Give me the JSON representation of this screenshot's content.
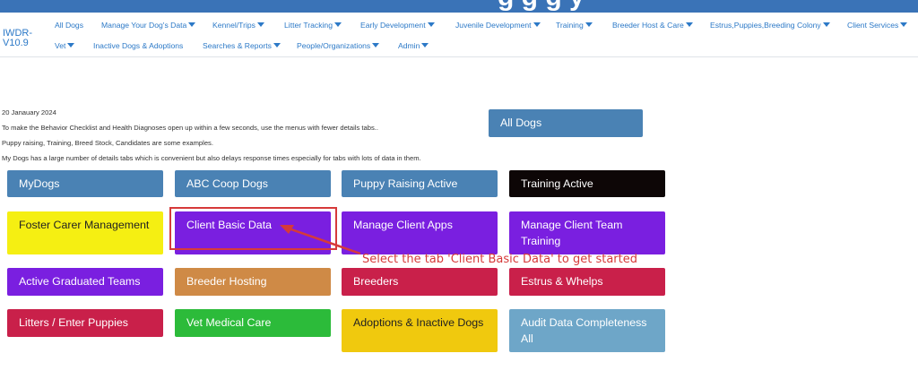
{
  "banner": {
    "title_fragment": "g g g y"
  },
  "brand": "IWDR-V10.9",
  "nav": {
    "row1": [
      {
        "label": "All Dogs",
        "caret": false
      },
      {
        "label": "Manage Your Dog's Data",
        "caret": true
      },
      {
        "label": "Kennel/Trips",
        "caret": true
      },
      {
        "label": "Litter Tracking",
        "caret": true
      },
      {
        "label": "Early Development",
        "caret": true
      },
      {
        "label": "Juvenile Development",
        "caret": true
      },
      {
        "label": "Training",
        "caret": true
      },
      {
        "label": "Breeder Host & Care",
        "caret": true
      },
      {
        "label": "Estrus,Puppies,Breeding Colony",
        "caret": true
      },
      {
        "label": "Client Services",
        "caret": true
      }
    ],
    "row2": [
      {
        "label": "Vet",
        "caret": true
      },
      {
        "label": "Inactive Dogs & Adoptions",
        "caret": false
      },
      {
        "label": "Searches & Reports",
        "caret": true
      },
      {
        "label": "People/Organizations",
        "caret": true
      },
      {
        "label": "Admin",
        "caret": true
      }
    ]
  },
  "notes": [
    "20 Janauary 2024",
    "To make the Behavior Checklist and Health Diagnoses open up within a few seconds,  use the menus with fewer details tabs..",
    "Puppy raising, Training, Breed Stock, Candidates are some examples.",
    "My Dogs has a large number of details tabs which is convenient but also delays response times especially for tabs with lots of data in them."
  ],
  "all_dogs_button": "All Dogs",
  "tiles": [
    {
      "label": "MyDogs",
      "color": "#4a82b4",
      "text_color": "#ffffff"
    },
    {
      "label": "ABC Coop Dogs",
      "color": "#4a82b4",
      "text_color": "#ffffff"
    },
    {
      "label": "Puppy Raising Active",
      "color": "#4a82b4",
      "text_color": "#ffffff"
    },
    {
      "label": "Training Active",
      "color": "#0d0606",
      "text_color": "#ffffff"
    },
    {
      "label": "Foster Carer Management",
      "color": "#f5ef12",
      "text_color": "#222222"
    },
    {
      "label": "Client Basic Data",
      "color": "#7a1fe0",
      "text_color": "#ffffff"
    },
    {
      "label": "Manage Client Apps",
      "color": "#7a1fe0",
      "text_color": "#ffffff"
    },
    {
      "label": "Manage Client Team Training",
      "color": "#7a1fe0",
      "text_color": "#ffffff"
    },
    {
      "label": "Active Graduated Teams",
      "color": "#7a1fe0",
      "text_color": "#ffffff"
    },
    {
      "label": "Breeder Hosting",
      "color": "#cf8a46",
      "text_color": "#ffffff"
    },
    {
      "label": "Breeders",
      "color": "#c9204a",
      "text_color": "#ffffff"
    },
    {
      "label": "Estrus & Whelps",
      "color": "#c9204a",
      "text_color": "#ffffff"
    },
    {
      "label": "Litters / Enter Puppies",
      "color": "#c9204a",
      "text_color": "#ffffff"
    },
    {
      "label": "Vet Medical Care",
      "color": "#2cbb3a",
      "text_color": "#ffffff"
    },
    {
      "label": "Adoptions & Inactive Dogs",
      "color": "#f0c90e",
      "text_color": "#222222"
    },
    {
      "label": "Audit Data Completeness All",
      "color": "#6ea6c8",
      "text_color": "#ffffff"
    }
  ],
  "annotation": {
    "text": "Select the tab 'Client Basic Data' to get started",
    "color": "#d63a3a"
  },
  "colors": {
    "banner": "#3a73b7",
    "nav_link": "#2c79c7",
    "all_dogs_button": "#4a82b4"
  }
}
